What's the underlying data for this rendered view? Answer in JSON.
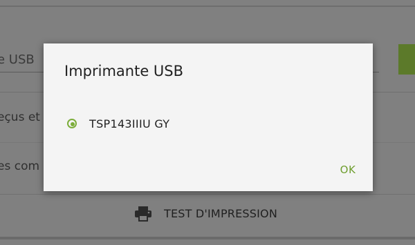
{
  "background": {
    "usb_field_partial": "e USB",
    "row1_partial": "eçus et",
    "row2_partial": "es com",
    "test_print_label": "TEST D'IMPRESSION",
    "printer_icon": "printer-icon"
  },
  "dialog": {
    "title": "Imprimante USB",
    "options": [
      {
        "label": "TSP143IIIU GY",
        "selected": true
      }
    ],
    "ok_label": "OK"
  },
  "colors": {
    "accent": "#7cad3a",
    "ok_text": "#6e9e2e",
    "scrim": "#808080",
    "dialog_bg": "#f4f4f4"
  }
}
